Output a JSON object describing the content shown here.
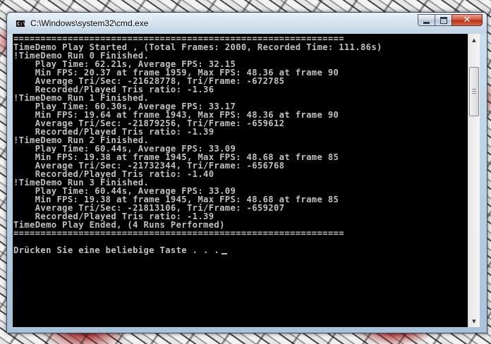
{
  "window": {
    "title": "C:\\Windows\\system32\\cmd.exe",
    "icon_label": "C:\\",
    "buttons": {
      "minimize": "minimize-icon",
      "maximize": "maximize-icon",
      "close": "✕"
    }
  },
  "console": {
    "lines": [
      "=============================================================",
      "TimeDemo Play Started , (Total Frames: 2000, Recorded Time: 111.86s)",
      "!TimeDemo Run 0 Finished.",
      "    Play Time: 62.21s, Average FPS: 32.15",
      "    Min FPS: 20.37 at frame 1959, Max FPS: 48.36 at frame 90",
      "    Average Tri/Sec: -21628778, Tri/Frame: -672785",
      "    Recorded/Played Tris ratio: -1.36",
      "!TimeDemo Run 1 Finished.",
      "    Play Time: 60.30s, Average FPS: 33.17",
      "    Min FPS: 19.64 at frame 1943, Max FPS: 48.36 at frame 90",
      "    Average Tri/Sec: -21879256, Tri/Frame: -659612",
      "    Recorded/Played Tris ratio: -1.39",
      "!TimeDemo Run 2 Finished.",
      "    Play Time: 60.44s, Average FPS: 33.09",
      "    Min FPS: 19.38 at frame 1945, Max FPS: 48.68 at frame 85",
      "    Average Tri/Sec: -21732344, Tri/Frame: -656768",
      "    Recorded/Played Tris ratio: -1.40",
      "!TimeDemo Run 3 Finished.",
      "    Play Time: 60.44s, Average FPS: 33.09",
      "    Min FPS: 19.38 at frame 1945, Max FPS: 48.68 at frame 85",
      "    Average Tri/Sec: -21813106, Tri/Frame: -659207",
      "    Recorded/Played Tris ratio: -1.39",
      "TimeDemo Play Ended, (4 Runs Performed)",
      "=============================================================",
      "",
      "Drücken Sie eine beliebige Taste . . ."
    ]
  },
  "scrollbar": {
    "up_arrow": "▲",
    "down_arrow": "▼"
  },
  "colors": {
    "console_bg": "#000000",
    "console_text": "#c0c0c0",
    "close_button": "#c8442a"
  }
}
